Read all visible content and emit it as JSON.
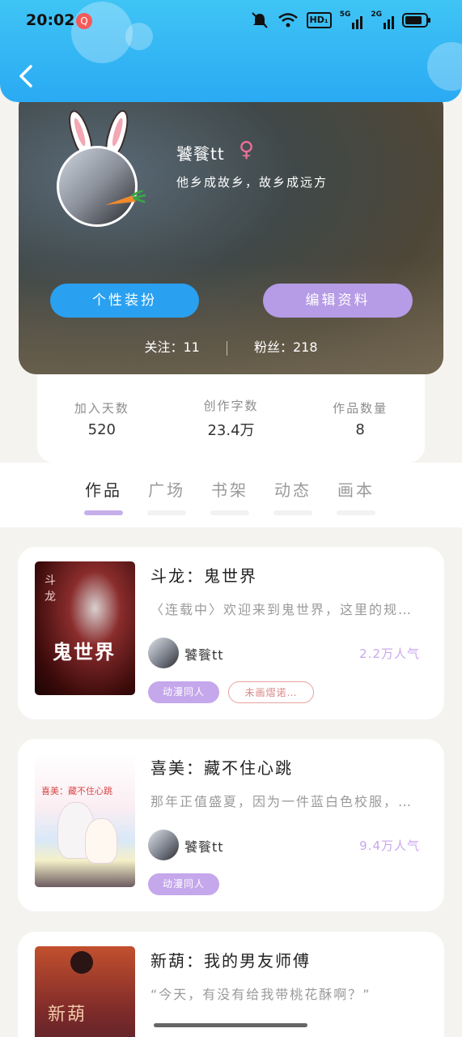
{
  "status_bar": {
    "time": "20:02",
    "notification_badge": "Q",
    "icons": [
      "mute-icon",
      "wifi-icon",
      "hd-icon",
      "5g-signal-icon",
      "2g-signal-icon",
      "battery-icon"
    ],
    "hd_label": "HD₁",
    "sig5g_label": "5G",
    "sig2g_label": "2G"
  },
  "header": {
    "back_icon": "chevron-left-icon"
  },
  "profile": {
    "nickname": "饕餮tt",
    "gender_symbol": "♀",
    "motto": "他乡成故乡，故乡成远方",
    "dress_button": "个性装扮",
    "edit_button": "编辑资料",
    "following": "关注：11",
    "followers": "粉丝：218"
  },
  "stats": [
    {
      "label": "加入天数",
      "value": "520"
    },
    {
      "label": "创作字数",
      "value": "23.4万"
    },
    {
      "label": "作品数量",
      "value": "8"
    }
  ],
  "tabs": [
    "作品",
    "广场",
    "书架",
    "动态",
    "画本"
  ],
  "active_tab": "作品",
  "works": [
    {
      "title": "斗龙：鬼世界",
      "desc": "〈连载中〉欢迎来到鬼世界，这里的规…",
      "author": "饕餮tt",
      "popularity": "2.2万人气",
      "tags": [
        "动漫同人",
        "未画熠诺…"
      ],
      "cover_text_top": "斗龙",
      "cover_text_main": "鬼世界"
    },
    {
      "title": "喜美：藏不住心跳",
      "desc": "那年正值盛夏，因为一件蓝白色校服，…",
      "author": "饕餮tt",
      "popularity": "9.4万人气",
      "tags": [
        "动漫同人"
      ],
      "cover_text_top": "喜美：藏不住心跳"
    },
    {
      "title": "新葫：我的男友师傅",
      "desc": "“今天，有没有给我带桃花酥啊？”",
      "cover_text_main": "新葫"
    }
  ],
  "colors": {
    "header_blue": "#2aaaf3",
    "accent_purple": "#b69be6",
    "button_blue": "#2aa0f0",
    "popularity_purple": "#c9a7ee"
  }
}
